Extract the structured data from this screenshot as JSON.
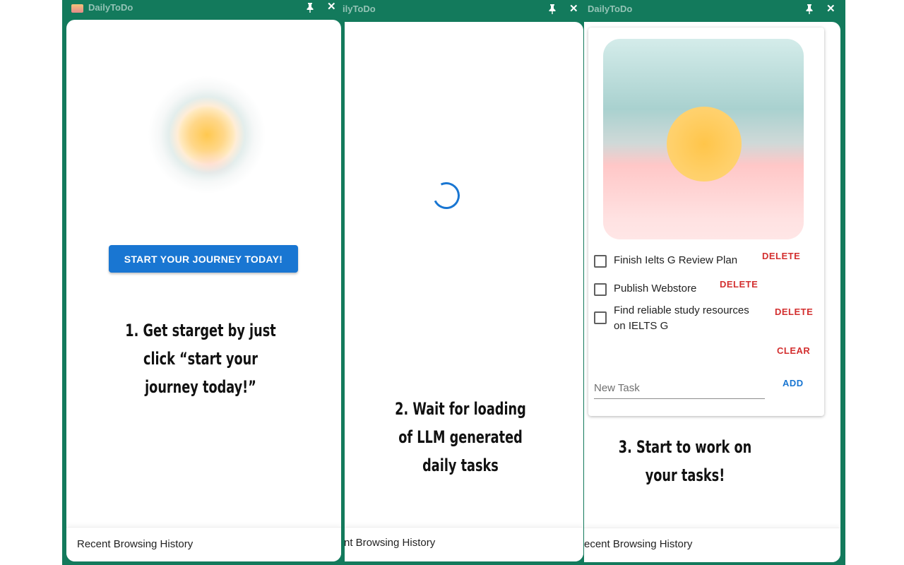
{
  "window": {
    "title": "DailyToDo",
    "close_symbol": "✕"
  },
  "panel1": {
    "start_button": "START YOUR JOURNEY TODAY!",
    "caption": [
      "1. Get starget by just",
      "click “start your",
      "journey today!”"
    ],
    "footer": "Recent Browsing History"
  },
  "panel2": {
    "title_partial": "ilyToDo",
    "caption": [
      "2. Wait for loading",
      "of LLM generated",
      "daily tasks"
    ],
    "footer": "nt Browsing History"
  },
  "panel3": {
    "tasks": [
      {
        "text_lines": [
          "Finish Ielts G Review Plan"
        ],
        "checked": false
      },
      {
        "text_lines": [
          "Publish Webstore"
        ],
        "checked": false
      },
      {
        "text_lines": [
          "Find reliable study resources",
          "on IELTS G"
        ],
        "checked": false
      }
    ],
    "delete_label": "DELETE",
    "clear_label": "CLEAR",
    "new_task_placeholder": "New Task",
    "add_label": "ADD",
    "caption": [
      "3. Start to work on",
      "your tasks!"
    ],
    "footer": "ecent Browsing History"
  },
  "colors": {
    "frame": "#137a5c",
    "primary": "#1976d2",
    "danger": "#d32f2f"
  }
}
